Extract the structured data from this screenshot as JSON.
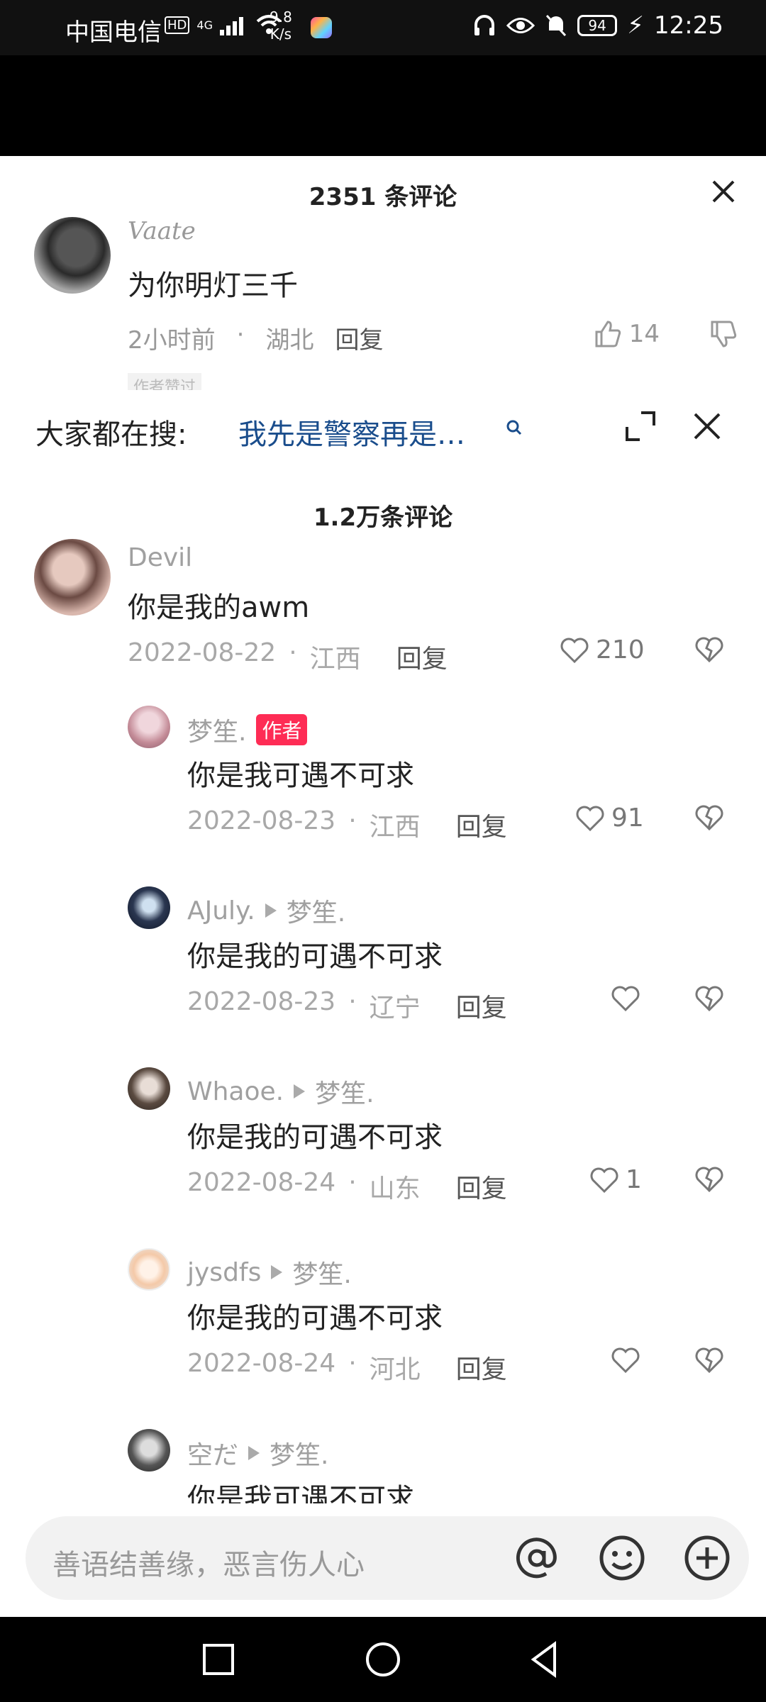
{
  "status_bar": {
    "carrier": "中国电信",
    "hd": "HD",
    "network": "4G",
    "speed_value": "9.8",
    "speed_unit": "K/s",
    "battery": "94",
    "time": "12:25"
  },
  "back_sheet": {
    "comment_count": "2351 条评论",
    "comment": {
      "user": "Vaate",
      "text": "为你明灯三千",
      "time": "2小时前",
      "location": "湖北",
      "reply_label": "回复",
      "likes": "14",
      "tag": "作者赞过"
    }
  },
  "search_bar": {
    "label": "大家都在搜:",
    "query": "我先是警察再是…"
  },
  "comments_header": "1.2万条评论",
  "comments": [
    {
      "user": "Devil",
      "text": "你是我的awm",
      "date": "2022-08-22",
      "location": "江西",
      "reply_label": "回复",
      "likes": "210"
    },
    {
      "user": "梦笙.",
      "badge": "作者",
      "text": "你是我可遇不可求",
      "date": "2022-08-23",
      "location": "江西",
      "reply_label": "回复",
      "likes": "91"
    },
    {
      "user": "AJuly.",
      "reply_to": "梦笙.",
      "text": "你是我的可遇不可求",
      "date": "2022-08-23",
      "location": "辽宁",
      "reply_label": "回复",
      "likes": ""
    },
    {
      "user": "Whaoe.",
      "reply_to": "梦笙.",
      "text": "你是我的可遇不可求",
      "date": "2022-08-24",
      "location": "山东",
      "reply_label": "回复",
      "likes": "1"
    },
    {
      "user": "jysdfs",
      "reply_to": "梦笙.",
      "text": "你是我的可遇不可求",
      "date": "2022-08-24",
      "location": "河北",
      "reply_label": "回复",
      "likes": ""
    },
    {
      "user": "空だ",
      "reply_to": "梦笙.",
      "text": "你是我可遇不可求"
    }
  ],
  "input_bar": {
    "placeholder": "善语结善缘，恶言伤人心"
  },
  "colors": {
    "accent": "#fe2c55",
    "search_link": "#1a4d8c",
    "muted": "#a0a0a0"
  }
}
